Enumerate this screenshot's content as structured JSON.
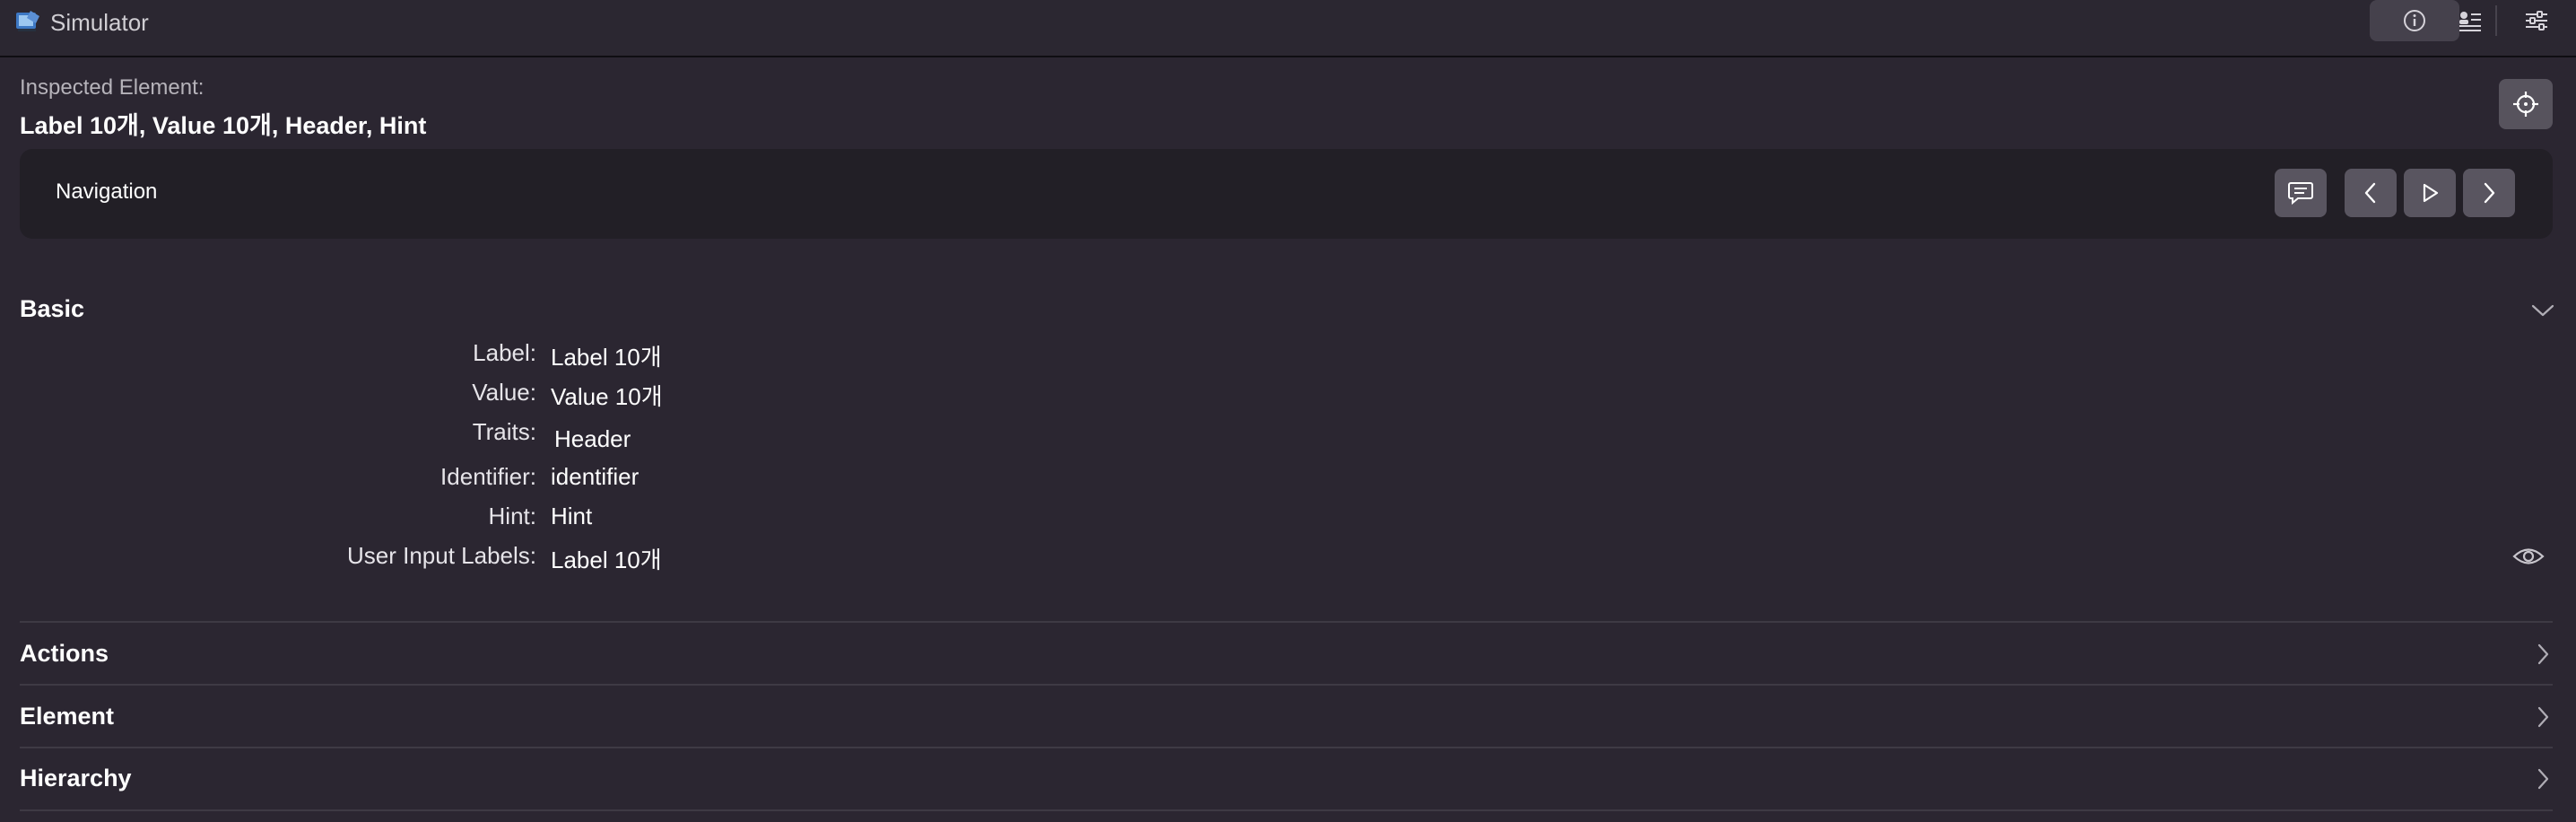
{
  "titlebar": {
    "app_name": "Simulator",
    "icons": [
      "simulator-app-icon",
      "info-icon",
      "list-icon",
      "sliders-icon"
    ]
  },
  "inspector": {
    "inspected_label": "Inspected Element:",
    "inspected_value": "Label 10개, Value 10개, Header, Hint",
    "target_icon": "crosshair-icon"
  },
  "navigation": {
    "title": "Navigation",
    "buttons": [
      "speech-bubble-icon",
      "chevron-left-icon",
      "play-icon",
      "chevron-right-icon"
    ]
  },
  "sections": {
    "basic": {
      "title": "Basic",
      "expanded": true,
      "properties": [
        {
          "key": "Label:",
          "value": "Label 10개"
        },
        {
          "key": "Value:",
          "value": "Value 10개"
        },
        {
          "key": "Traits:",
          "value": "Header"
        },
        {
          "key": "Identifier:",
          "value": "identifier"
        },
        {
          "key": "Hint:",
          "value": "Hint"
        },
        {
          "key": "User Input Labels:",
          "value": "Label 10개"
        }
      ]
    },
    "actions": {
      "title": "Actions"
    },
    "element": {
      "title": "Element"
    },
    "hierarchy": {
      "title": "Hierarchy"
    }
  },
  "colors": {
    "background": "#2b2631",
    "panel": "#221f26",
    "button": "#595560",
    "text": "#ffffff"
  }
}
